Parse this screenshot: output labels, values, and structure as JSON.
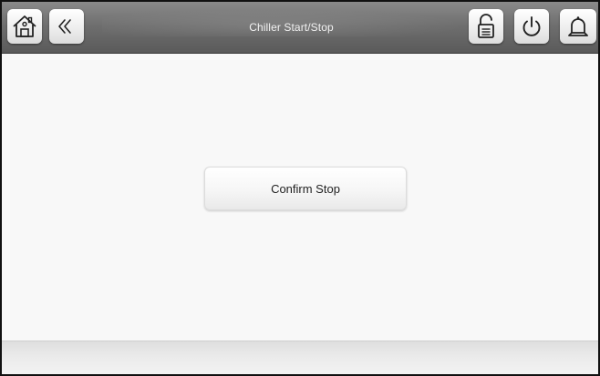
{
  "header": {
    "title": "Chiller Start/Stop",
    "buttons": {
      "home": {
        "icon": "home-icon"
      },
      "back": {
        "icon": "double-chevron-left-icon"
      },
      "lock": {
        "icon": "unlocked-padlock-icon"
      },
      "power": {
        "icon": "power-icon"
      },
      "alarm": {
        "icon": "bell-icon"
      }
    }
  },
  "main": {
    "confirm_stop_label": "Confirm Stop"
  },
  "colors": {
    "header_bar": "#6f6f6f",
    "title_text": "#f0f0f0",
    "background": "#f8f8f8",
    "button_face": "#f6f6f6",
    "button_text": "#222222"
  }
}
